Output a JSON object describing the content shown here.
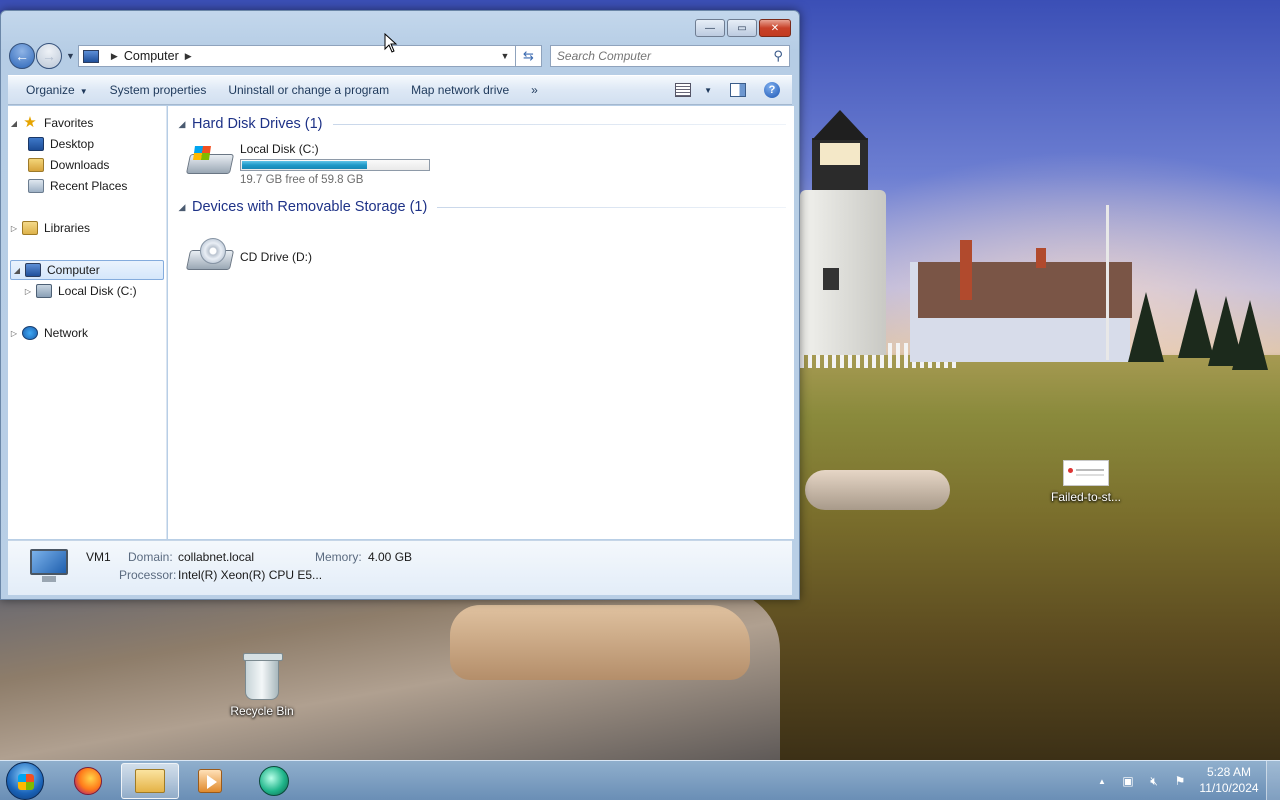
{
  "window": {
    "address_location": "Computer",
    "search_placeholder": "Search Computer",
    "controls": {
      "minimize": "—",
      "maximize": "▭",
      "close": "✕"
    }
  },
  "toolbar": {
    "organize": "Organize",
    "system_properties": "System properties",
    "uninstall": "Uninstall or change a program",
    "map_network_drive": "Map network drive",
    "more": "»"
  },
  "navpane": {
    "favorites": "Favorites",
    "desktop": "Desktop",
    "downloads": "Downloads",
    "recent_places": "Recent Places",
    "libraries": "Libraries",
    "computer": "Computer",
    "local_disk": "Local Disk (C:)",
    "network": "Network"
  },
  "content": {
    "hdd_group": "Hard Disk Drives (1)",
    "removable_group": "Devices with Removable Storage (1)",
    "local_disk": {
      "name": "Local Disk (C:)",
      "free_text": "19.7 GB free of 59.8 GB",
      "used_fraction": 0.67
    },
    "cd_drive": {
      "name": "CD Drive (D:)"
    }
  },
  "details": {
    "computer_name": "VM1",
    "domain_label": "Domain:",
    "domain_value": "collabnet.local",
    "memory_label": "Memory:",
    "memory_value": "4.00 GB",
    "processor_label": "Processor:",
    "processor_value": "Intel(R) Xeon(R) CPU E5..."
  },
  "desktop_icons": {
    "recycle_bin": "Recycle Bin",
    "failed_file": "Failed-to-st..."
  },
  "taskbar": {
    "time": "5:28 AM",
    "date": "11/10/2024",
    "tray_arrow": "▲"
  },
  "icons": {
    "back": "arrow-left-icon",
    "forward": "arrow-right-icon",
    "refresh": "refresh-icon",
    "search": "search-icon",
    "help": "help-icon"
  }
}
